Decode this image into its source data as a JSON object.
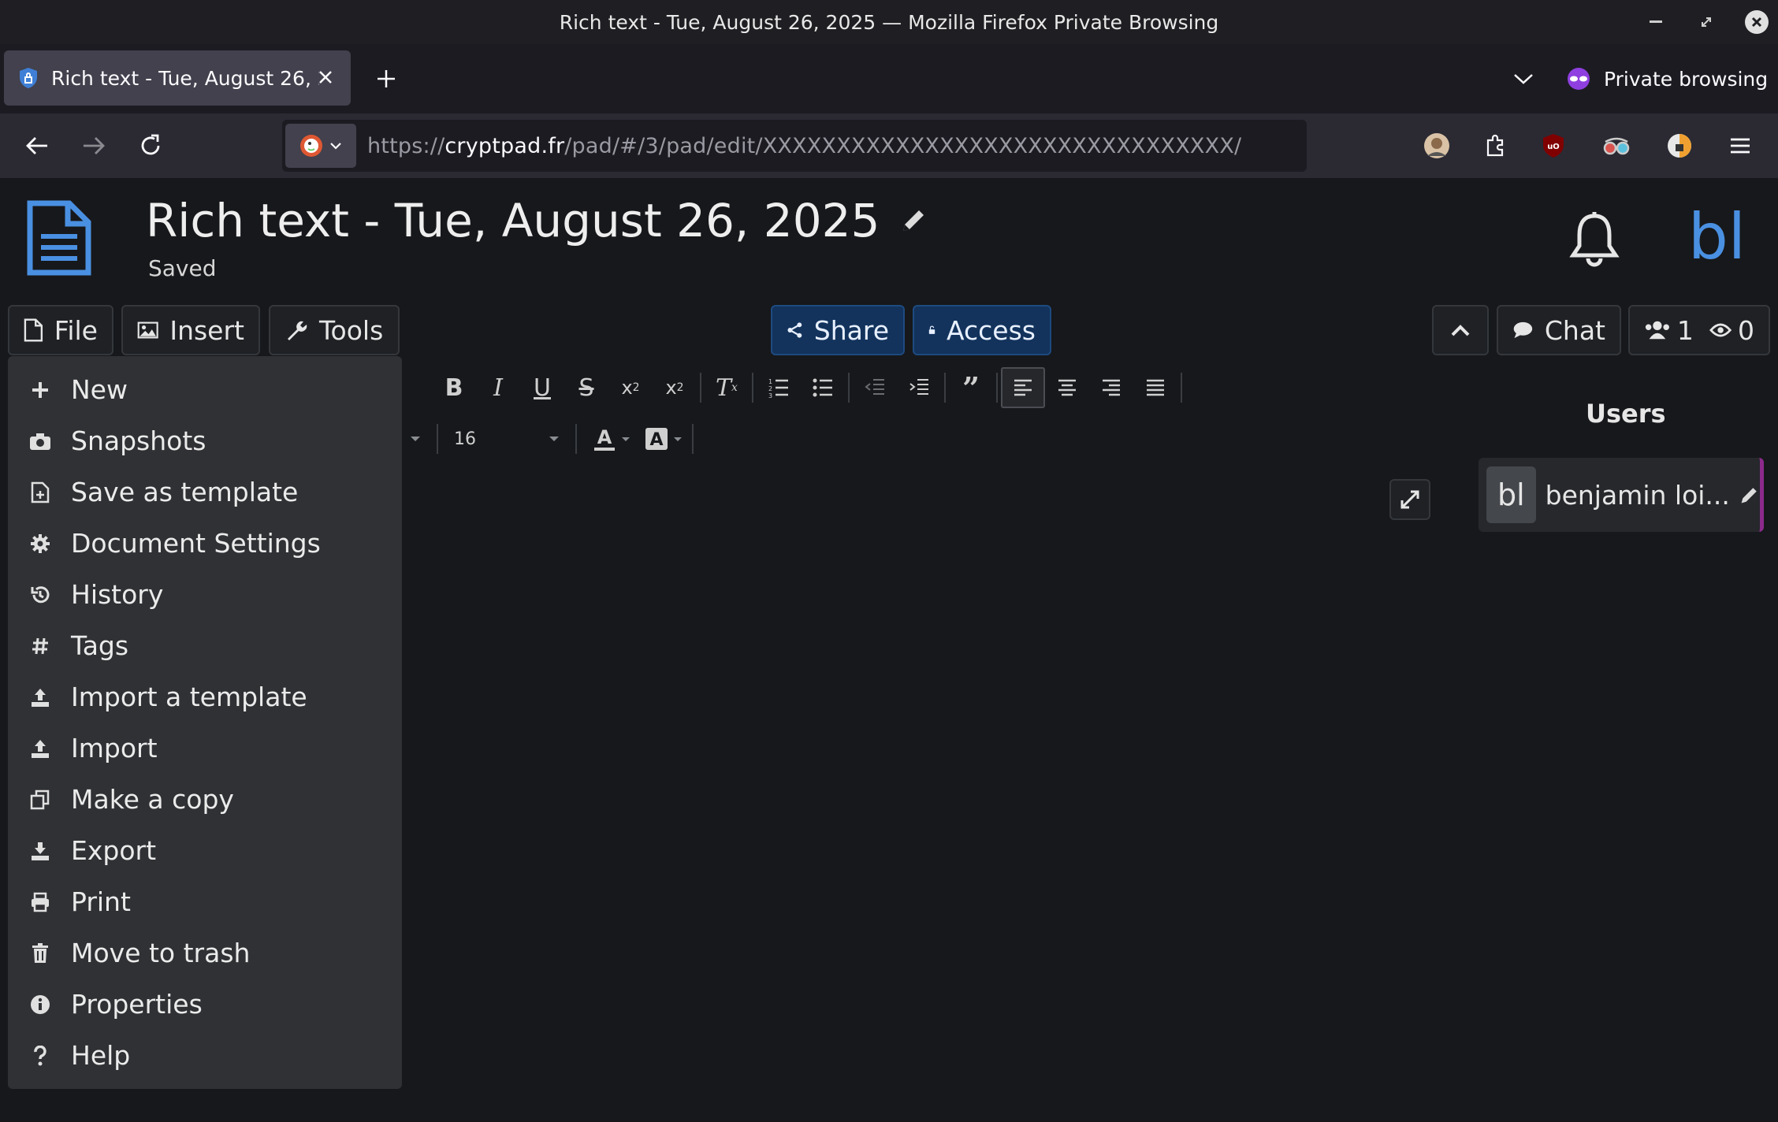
{
  "window": {
    "title": "Rich text - Tue, August 26, 2025 — Mozilla Firefox Private Browsing"
  },
  "browser": {
    "tab_title": "Rich text - Tue, August 26, 2025",
    "private_label": "Private browsing",
    "url_scheme": "https://",
    "url_host": "cryptpad.fr",
    "url_path": "/pad/#/3/pad/edit/XXXXXXXXXXXXXXXXXXXXXXXXXXXXXXXX/"
  },
  "pad": {
    "title": "Rich text - Tue, August 26, 2025",
    "status": "Saved",
    "user_initials": "bl"
  },
  "toolbar": {
    "file": "File",
    "insert": "Insert",
    "tools": "Tools",
    "share": "Share",
    "access": "Access",
    "chat": "Chat",
    "editors_count": "1",
    "viewers_count": "0"
  },
  "format": {
    "font_size": "16"
  },
  "users_panel": {
    "heading": "Users",
    "user_initials": "bl",
    "user_name": "benjamin loi..."
  },
  "file_menu": [
    {
      "label": "New",
      "icon": "plus-icon"
    },
    {
      "label": "Snapshots",
      "icon": "camera-icon"
    },
    {
      "label": "Save as template",
      "icon": "file-plus-icon"
    },
    {
      "label": "Document Settings",
      "icon": "gear-icon"
    },
    {
      "label": "History",
      "icon": "history-icon"
    },
    {
      "label": "Tags",
      "icon": "hash-icon"
    },
    {
      "label": "Import a template",
      "icon": "upload-icon"
    },
    {
      "label": "Import",
      "icon": "upload-icon"
    },
    {
      "label": "Make a copy",
      "icon": "copy-icon"
    },
    {
      "label": "Export",
      "icon": "download-icon"
    },
    {
      "label": "Print",
      "icon": "printer-icon"
    },
    {
      "label": "Move to trash",
      "icon": "trash-icon"
    },
    {
      "label": "Properties",
      "icon": "info-icon"
    },
    {
      "label": "Help",
      "icon": "question-icon"
    }
  ],
  "colors": {
    "accent_blue": "#4a90e2",
    "share_button": "#13335c",
    "user_border": "#8c2a8c"
  }
}
